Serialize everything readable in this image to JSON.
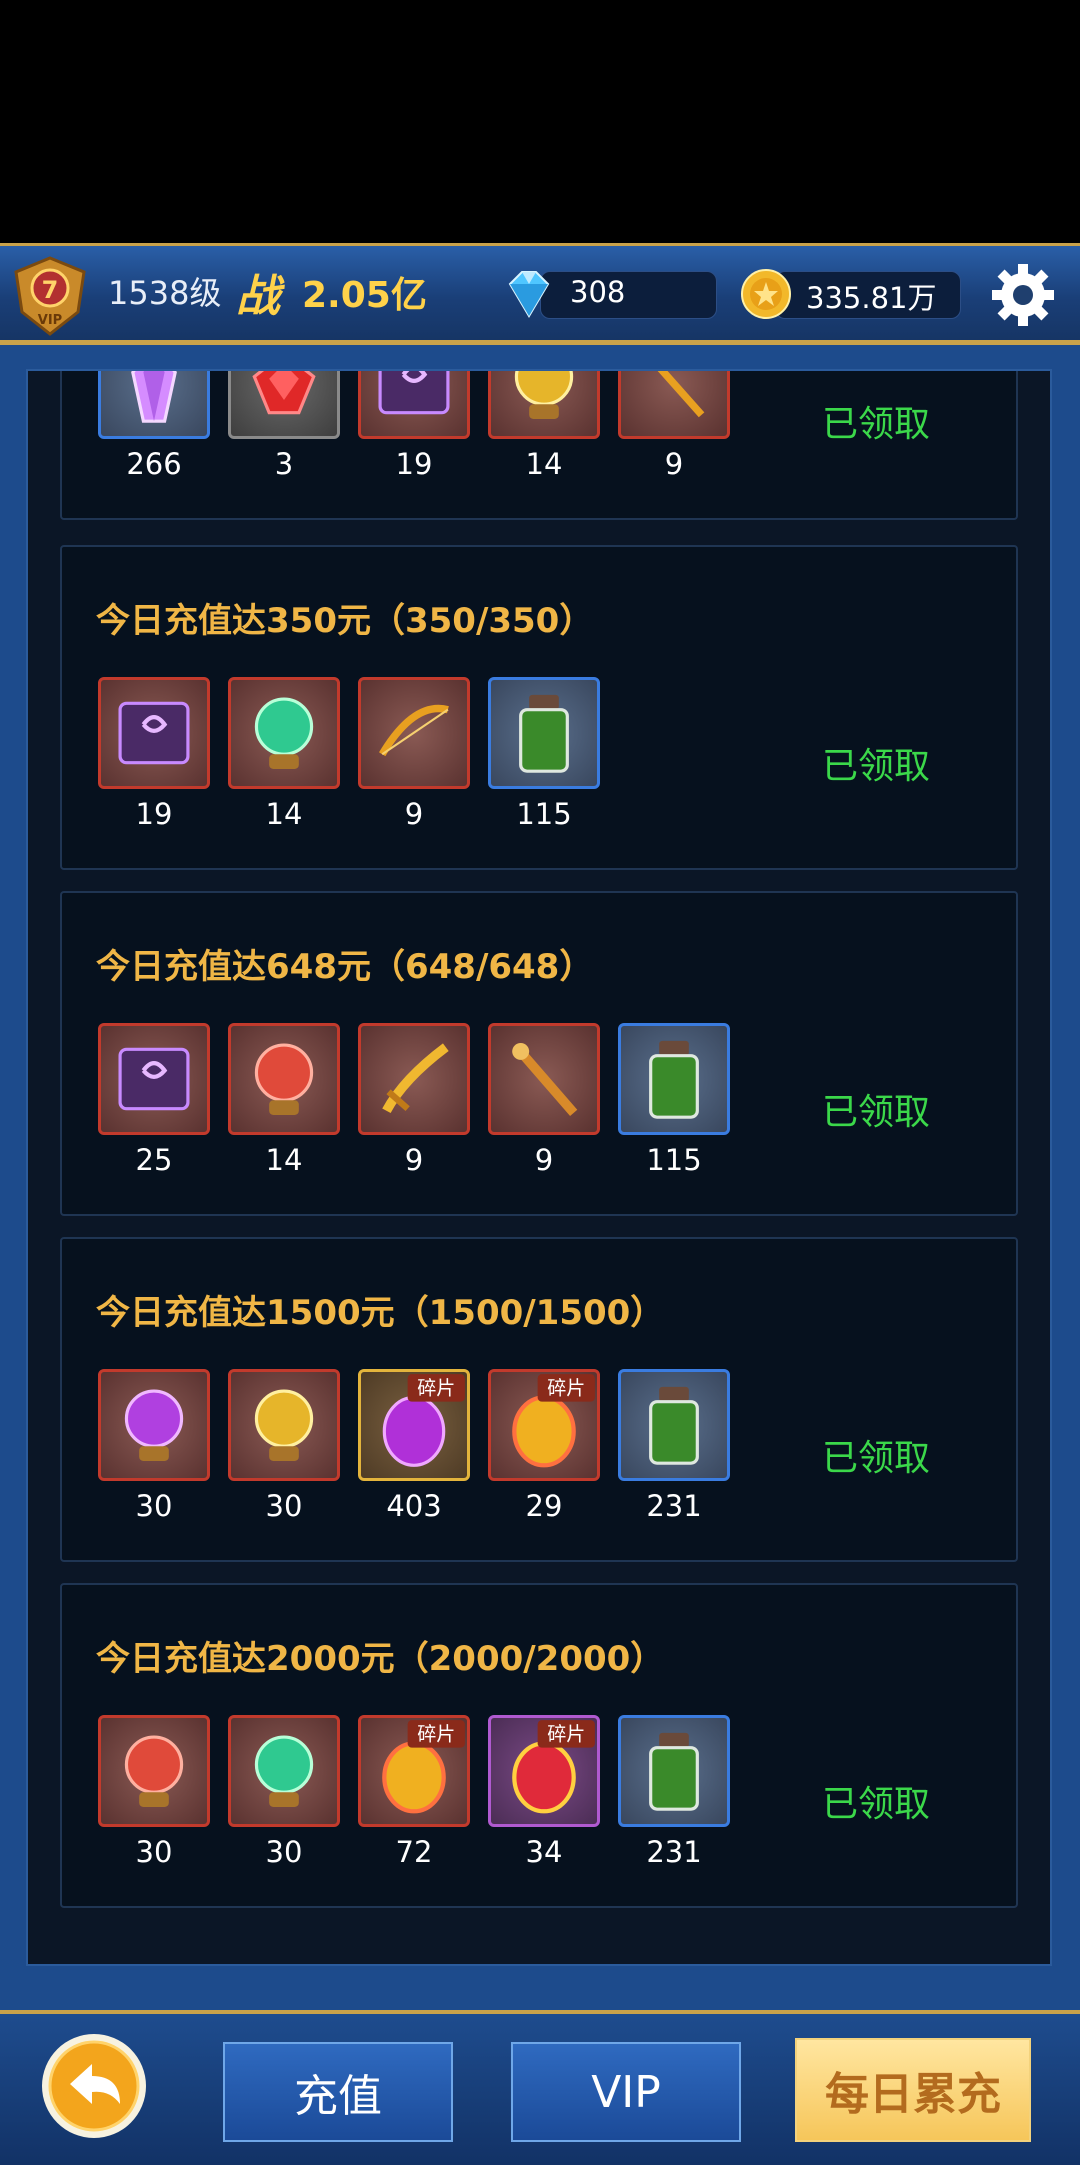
{
  "header": {
    "vip_level": "7",
    "vip_label": "VIP",
    "player_level": "1538级",
    "power_icon_text": "战",
    "power_value": "2.05亿",
    "diamonds": "308",
    "gold": "335.81万"
  },
  "rows": [
    {
      "title": "",
      "status": "已领取",
      "items": [
        {
          "icon": "purple-crystal-icon",
          "frame": "blue",
          "count": "266"
        },
        {
          "icon": "red-gem-icon",
          "frame": "gray",
          "count": "3"
        },
        {
          "icon": "spell-book-icon",
          "frame": "red",
          "count": "19"
        },
        {
          "icon": "gold-orb-icon",
          "frame": "red",
          "count": "14"
        },
        {
          "icon": "gold-staff-icon",
          "frame": "red",
          "count": "9"
        }
      ]
    },
    {
      "title": "今日充值达350元（350/350）",
      "status": "已领取",
      "items": [
        {
          "icon": "spell-book-icon",
          "frame": "red",
          "count": "19"
        },
        {
          "icon": "green-orb-icon",
          "frame": "red",
          "count": "14"
        },
        {
          "icon": "gold-bow-icon",
          "frame": "red",
          "count": "9"
        },
        {
          "icon": "green-potion-icon",
          "frame": "blue",
          "count": "115"
        }
      ]
    },
    {
      "title": "今日充值达648元（648/648）",
      "status": "已领取",
      "items": [
        {
          "icon": "spell-book-icon",
          "frame": "red",
          "count": "25"
        },
        {
          "icon": "red-orb-icon",
          "frame": "red",
          "count": "14"
        },
        {
          "icon": "gold-sword-icon",
          "frame": "red",
          "count": "9"
        },
        {
          "icon": "wooden-staff-icon",
          "frame": "red",
          "count": "9"
        },
        {
          "icon": "green-potion-icon",
          "frame": "blue",
          "count": "115"
        }
      ]
    },
    {
      "title": "今日充值达1500元（1500/1500）",
      "status": "已领取",
      "items": [
        {
          "icon": "purple-orb-icon",
          "frame": "red",
          "count": "30"
        },
        {
          "icon": "gold-orb-icon",
          "frame": "red",
          "count": "30"
        },
        {
          "icon": "purple-egg-fragment-icon",
          "frame": "gold",
          "count": "403",
          "tag": "碎片"
        },
        {
          "icon": "gold-egg-fragment-icon",
          "frame": "red",
          "count": "29",
          "tag": "碎片"
        },
        {
          "icon": "green-potion-icon",
          "frame": "blue",
          "count": "231"
        }
      ]
    },
    {
      "title": "今日充值达2000元（2000/2000）",
      "status": "已领取",
      "items": [
        {
          "icon": "red-orb-icon",
          "frame": "red",
          "count": "30"
        },
        {
          "icon": "green-orb-icon",
          "frame": "red",
          "count": "30"
        },
        {
          "icon": "gold-egg-fragment-icon",
          "frame": "red",
          "count": "72",
          "tag": "碎片"
        },
        {
          "icon": "red-egg-fragment-icon",
          "frame": "purple",
          "count": "34",
          "tag": "碎片"
        },
        {
          "icon": "green-potion-icon",
          "frame": "blue",
          "count": "231"
        }
      ]
    }
  ],
  "footer": {
    "recharge_label": "充值",
    "vip_label": "VIP",
    "daily_label": "每日累充"
  },
  "colors": {
    "title_gold": "#f0b646",
    "status_green": "#3bd84a",
    "frame_blue": "#1d4b8c"
  }
}
